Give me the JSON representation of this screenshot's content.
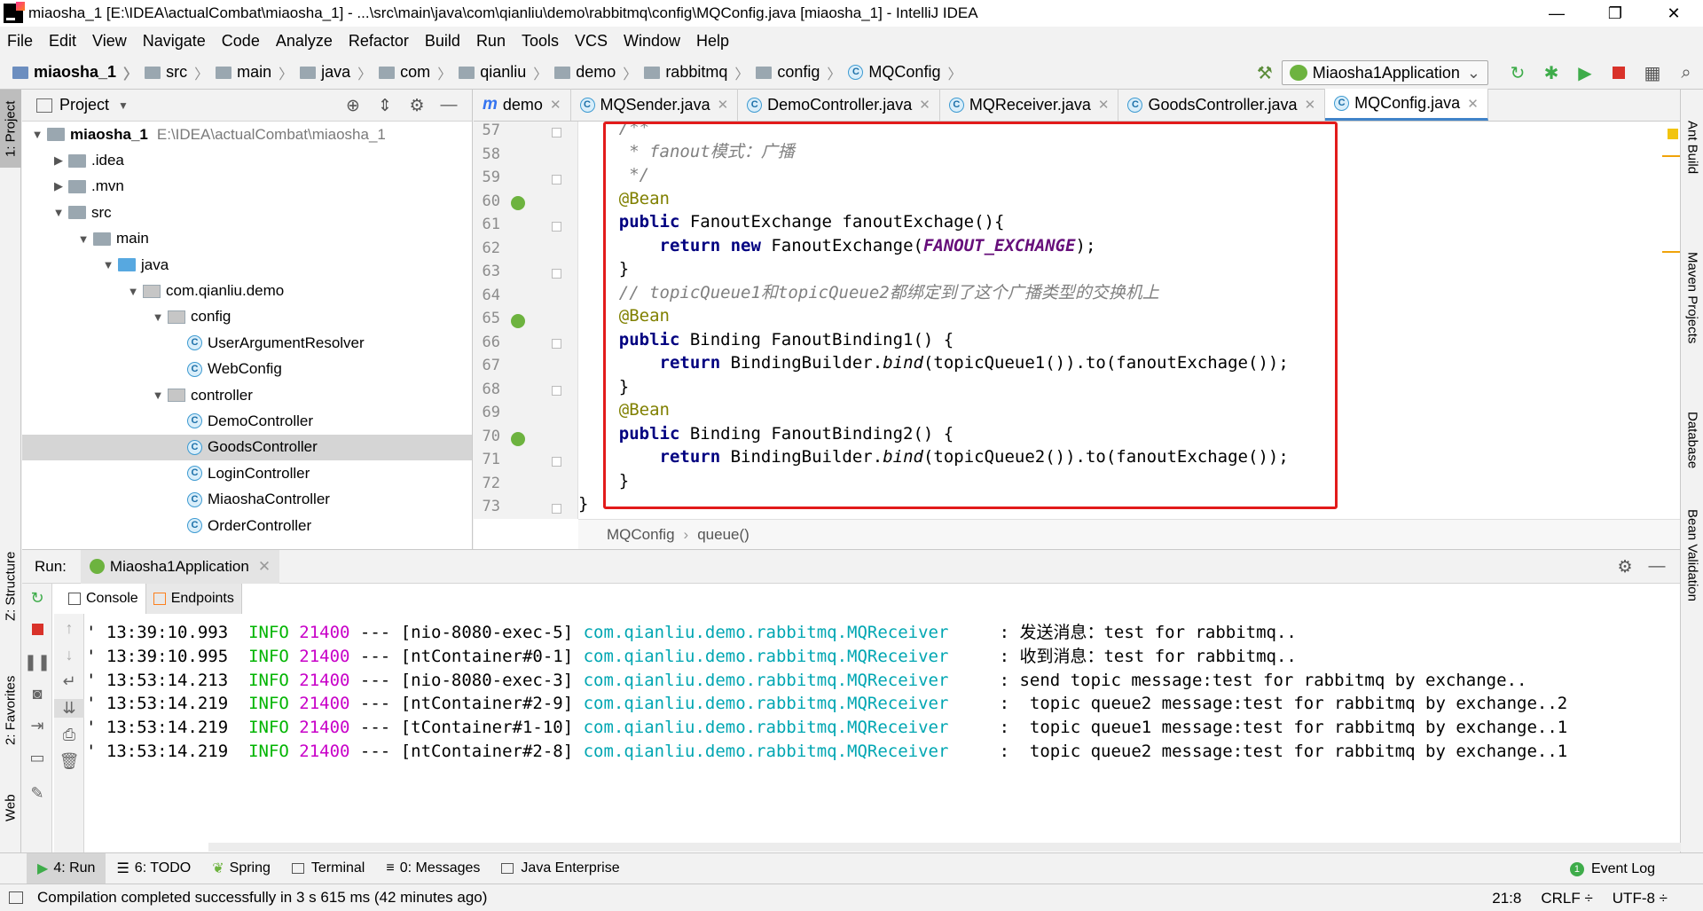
{
  "window": {
    "title": "miaosha_1 [E:\\IDEA\\actualCombat\\miaosha_1] - ...\\src\\main\\java\\com\\qianliu\\demo\\rabbitmq\\config\\MQConfig.java [miaosha_1] - IntelliJ IDEA",
    "minimize": "—",
    "maximize": "❐",
    "close": "✕"
  },
  "menu": [
    "File",
    "Edit",
    "View",
    "Navigate",
    "Code",
    "Analyze",
    "Refactor",
    "Build",
    "Run",
    "Tools",
    "VCS",
    "Window",
    "Help"
  ],
  "nav": {
    "crumbs": [
      "miaosha_1",
      "src",
      "main",
      "java",
      "com",
      "qianliu",
      "demo",
      "rabbitmq",
      "config",
      "MQConfig"
    ],
    "run_config": "Miaosha1Application"
  },
  "left_tabs": {
    "project": "1: Project",
    "structure": "Z: Structure",
    "favorites": "2: Favorites",
    "web": "Web"
  },
  "right_tabs": {
    "ant": "Ant Build",
    "maven": "Maven Projects",
    "database": "Database",
    "bean": "Bean Validation"
  },
  "project_panel": {
    "title": "Project",
    "root": {
      "name": "miaosha_1",
      "path": "E:\\IDEA\\actualCombat\\miaosha_1"
    },
    "items": [
      {
        "label": ".idea",
        "type": "folder"
      },
      {
        "label": ".mvn",
        "type": "folder"
      },
      {
        "label": "src",
        "type": "folder"
      },
      {
        "label": "main",
        "type": "folder"
      },
      {
        "label": "java",
        "type": "folder-blue"
      },
      {
        "label": "com.qianliu.demo",
        "type": "package"
      },
      {
        "label": "config",
        "type": "package"
      },
      {
        "label": "UserArgumentResolver",
        "type": "class"
      },
      {
        "label": "WebConfig",
        "type": "class"
      },
      {
        "label": "controller",
        "type": "package"
      },
      {
        "label": "DemoController",
        "type": "class"
      },
      {
        "label": "GoodsController",
        "type": "class"
      },
      {
        "label": "LoginController",
        "type": "class"
      },
      {
        "label": "MiaoshaController",
        "type": "class"
      },
      {
        "label": "OrderController",
        "type": "class"
      }
    ]
  },
  "editor": {
    "tabs": [
      {
        "label": "demo",
        "kind": "maven"
      },
      {
        "label": "MQSender.java",
        "kind": "class"
      },
      {
        "label": "DemoController.java",
        "kind": "class"
      },
      {
        "label": "MQReceiver.java",
        "kind": "class"
      },
      {
        "label": "GoodsController.java",
        "kind": "class"
      },
      {
        "label": "MQConfig.java",
        "kind": "class"
      }
    ],
    "line_numbers": [
      "57",
      "58",
      "59",
      "60",
      "61",
      "62",
      "63",
      "64",
      "65",
      "66",
      "67",
      "68",
      "69",
      "70",
      "71",
      "72",
      "73"
    ],
    "code": {
      "l57": "    /**",
      "l58a": "     * fanout",
      "l58b": "模式：广播",
      "l59": "     */",
      "l60": "    @Bean",
      "l61a": "    public",
      "l61b": " FanoutExchange fanoutExchage(){",
      "l62a": "        return",
      "l62b": " new",
      "l62c": " FanoutExchange(",
      "l62d": "FANOUT_EXCHANGE",
      "l62e": ");",
      "l63": "    }",
      "l64": "    // topicQueue1和topicQueue2都绑定到了这个广播类型的交换机上",
      "l65": "    @Bean",
      "l66a": "    public",
      "l66b": " Binding FanoutBinding1() {",
      "l67a": "        return",
      "l67b": " BindingBuilder.",
      "l67c": "bind",
      "l67d": "(topicQueue1()).to(fanoutExchage());",
      "l68": "    }",
      "l69": "    @Bean",
      "l70a": "    public",
      "l70b": " Binding FanoutBinding2() {",
      "l71a": "        return",
      "l71b": " BindingBuilder.",
      "l71c": "bind",
      "l71d": "(topicQueue2()).to(fanoutExchage());",
      "l72": "    }",
      "l73": "}"
    },
    "breadcrumb": [
      "MQConfig",
      "queue()"
    ]
  },
  "run_panel": {
    "label": "Run:",
    "tab": "Miaosha1Application",
    "subtabs": [
      "Console",
      "Endpoints"
    ],
    "log": [
      {
        "pre": "' ",
        "time": "13:39:10.993",
        "level": "INFO",
        "pid": "21400",
        "sep": " --- ",
        "thread": "[nio-8080-exec-5]",
        "cls": "com.qianliu.demo.rabbitmq.MQReceiver",
        "msg": "     : 发送消息：test for rabbitmq.."
      },
      {
        "pre": "' ",
        "time": "13:39:10.995",
        "level": "INFO",
        "pid": "21400",
        "sep": " --- ",
        "thread": "[ntContainer#0-1]",
        "cls": "com.qianliu.demo.rabbitmq.MQReceiver",
        "msg": "     : 收到消息：test for rabbitmq.."
      },
      {
        "pre": "' ",
        "time": "13:53:14.213",
        "level": "INFO",
        "pid": "21400",
        "sep": " --- ",
        "thread": "[nio-8080-exec-3]",
        "cls": "com.qianliu.demo.rabbitmq.MQReceiver",
        "msg": "     : send topic message:test for rabbitmq by exchange.."
      },
      {
        "pre": "' ",
        "time": "13:53:14.219",
        "level": "INFO",
        "pid": "21400",
        "sep": " --- ",
        "thread": "[ntContainer#2-9]",
        "cls": "com.qianliu.demo.rabbitmq.MQReceiver",
        "msg": "     :  topic queue2 message:test for rabbitmq by exchange..2"
      },
      {
        "pre": "' ",
        "time": "13:53:14.219",
        "level": "INFO",
        "pid": "21400",
        "sep": " --- ",
        "thread": "[tContainer#1-10]",
        "cls": "com.qianliu.demo.rabbitmq.MQReceiver",
        "msg": "     :  topic queue1 message:test for rabbitmq by exchange..1"
      },
      {
        "pre": "' ",
        "time": "13:53:14.219",
        "level": "INFO",
        "pid": "21400",
        "sep": " --- ",
        "thread": "[ntContainer#2-8]",
        "cls": "com.qianliu.demo.rabbitmq.MQReceiver",
        "msg": "     :  topic queue2 message:test for rabbitmq by exchange..1"
      }
    ]
  },
  "bottom_tools": [
    "4: Run",
    "6: TODO",
    "Spring",
    "Terminal",
    "0: Messages",
    "Java Enterprise"
  ],
  "event_log": "Event Log",
  "status": {
    "message": "Compilation completed successfully in 3 s 615 ms (42 minutes ago)",
    "position": "21:8",
    "line_sep": "CRLF ÷",
    "encoding": "UTF-8 ÷"
  },
  "colors": {
    "accent": "#4083c9",
    "highlight_box": "#e21b1b",
    "spring": "#6db33f",
    "keyword": "#000080",
    "annotation": "#808000"
  }
}
